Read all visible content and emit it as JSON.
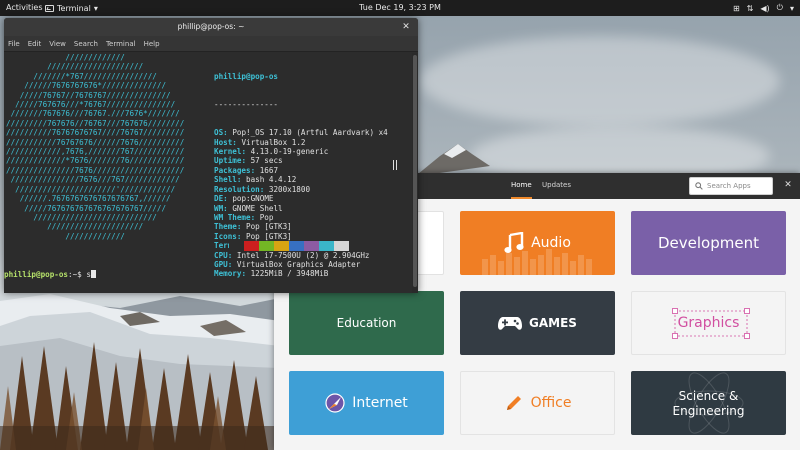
{
  "topbar": {
    "activities": "Activities",
    "app_name": "Terminal",
    "app_chevron": "▾",
    "clock": "Tue Dec 19,  3:23 PM",
    "tray": {
      "grid": "⊞",
      "network": "⇅",
      "volume": "◀)",
      "power": "⏻",
      "chevron": "▾"
    }
  },
  "terminal": {
    "title": "phillip@pop-os: ~",
    "close": "✕",
    "menu": [
      "File",
      "Edit",
      "View",
      "Search",
      "Terminal",
      "Help"
    ],
    "ascii": [
      "             /////////////",
      "         /////////////////////",
      "      ///////*767////////////////",
      "    //////7676767676*//////////////",
      "   /////76767//7676767//////////////",
      "  /////767676///*76767///////////////",
      " ///////767676///76767.///7676*///////",
      "/////////767676//76767///767676////////",
      "//////////76767676767////76767/////////",
      "///////////76767676//////7676//////////",
      "////////////,7676,///////767///////////",
      "/////////////*7676///////76////////////",
      "///////////////7676////////////////////",
      " ///////////////7676///767////////////",
      "  //////////////////////'////////////",
      "   //////.7676767676767676767,//////",
      "    /////767676767676767676767/////",
      "      ///////////////////////////",
      "         /////////////////////",
      "             /////////////"
    ],
    "user_host": "phillip@pop-os",
    "separator": "--------------",
    "info": [
      {
        "key": "OS",
        "value": "Pop!_OS 17.10 (Artful Aardvark) x4"
      },
      {
        "key": "Host",
        "value": "VirtualBox 1.2"
      },
      {
        "key": "Kernel",
        "value": "4.13.0-19-generic"
      },
      {
        "key": "Uptime",
        "value": "57 secs"
      },
      {
        "key": "Packages",
        "value": "1667"
      },
      {
        "key": "Shell",
        "value": "bash 4.4.12"
      },
      {
        "key": "Resolution",
        "value": "3200x1800"
      },
      {
        "key": "DE",
        "value": "pop:GNOME"
      },
      {
        "key": "WM",
        "value": "GNOME Shell"
      },
      {
        "key": "WM Theme",
        "value": "Pop"
      },
      {
        "key": "Theme",
        "value": "Pop [GTK3]"
      },
      {
        "key": "Icons",
        "value": "Pop [GTK3]"
      },
      {
        "key": "Terminal",
        "value": "gnome-terminal"
      },
      {
        "key": "CPU",
        "value": "Intel i7-7500U (2) @ 2.904GHz"
      },
      {
        "key": "GPU",
        "value": "VirtualBox Graphics Adapter"
      },
      {
        "key": "Memory",
        "value": "1225MiB / 3948MiB"
      }
    ],
    "palette": [
      "#2c2c2c",
      "#cc1f1f",
      "#73b624",
      "#d7a413",
      "#3770c2",
      "#8c5ba3",
      "#3ab6c9",
      "#d6d6d6"
    ],
    "prompt": {
      "user": "phillip@pop-os",
      "path": ":~$ ",
      "command": "s"
    }
  },
  "shop": {
    "tabs": [
      {
        "label": "Home",
        "active": true
      },
      {
        "label": "Updates",
        "active": false
      }
    ],
    "search_placeholder": "Search Apps",
    "close": "✕",
    "tiles": [
      {
        "label": "Audio",
        "bg": "#f07e24",
        "fg": "#ffffff",
        "icon": "music-note-icon"
      },
      {
        "label": "Development",
        "bg": "#7a60a8",
        "fg": "#ffffff",
        "icon": ""
      },
      {
        "label": "Education",
        "bg": "#2f6a4c",
        "fg": "#ffffff",
        "icon": ""
      },
      {
        "label": "GAMES",
        "bg": "#343c44",
        "fg": "#ffffff",
        "icon": "gamepad-icon"
      },
      {
        "label": "Graphics",
        "bg": "#f4f4f4",
        "fg": "#d14fa0",
        "icon": "selection-box-icon"
      },
      {
        "label": "Internet",
        "bg": "#3e9fd6",
        "fg": "#ffffff",
        "icon": "globe-icon"
      },
      {
        "label": "Office",
        "bg": "#f4f4f4",
        "fg": "#f07e24",
        "icon": "pen-icon"
      },
      {
        "label": "Science & Engineering",
        "line1": "Science &",
        "line2": "Engineering",
        "bg": "#2f3a42",
        "fg": "#ffffff",
        "icon": "atom-icon"
      }
    ]
  }
}
